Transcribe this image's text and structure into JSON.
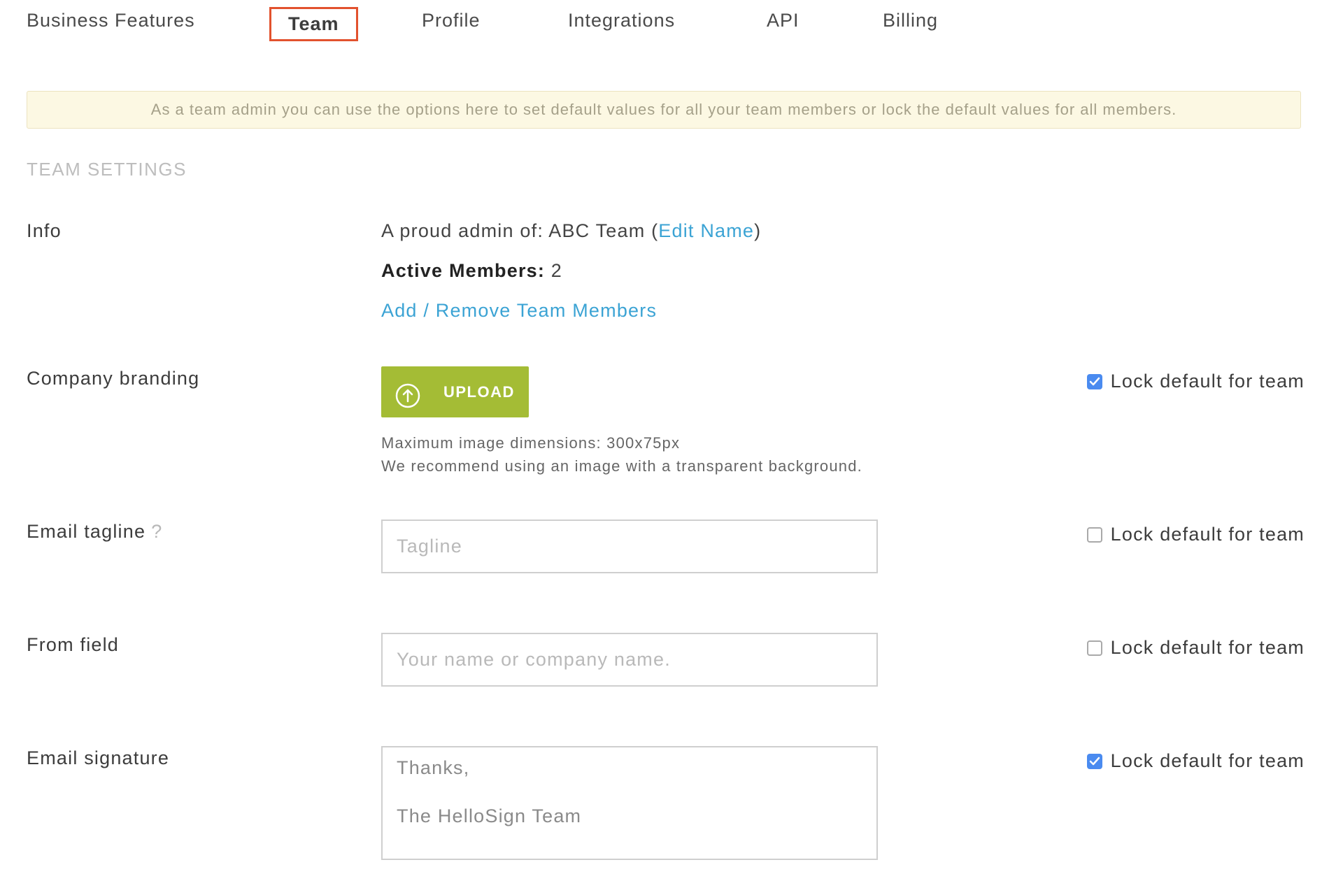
{
  "nav": {
    "tabs": [
      {
        "label": "Business Features"
      },
      {
        "label": "Team",
        "active": true
      },
      {
        "label": "Profile"
      },
      {
        "label": "Integrations"
      },
      {
        "label": "API"
      },
      {
        "label": "Billing"
      }
    ]
  },
  "banner": {
    "text": "As a team admin you can use the options here to set default values for all your team members or lock the default values for all members."
  },
  "section_title": "TEAM SETTINGS",
  "info": {
    "label": "Info",
    "admin_prefix": "A proud admin of: ABC Team (",
    "edit_name": "Edit Name",
    "admin_suffix": ")",
    "active_members_label": "Active Members:",
    "active_members_count": "2",
    "add_remove_link": "Add / Remove Team Members"
  },
  "branding": {
    "label": "Company branding",
    "upload_label": "UPLOAD",
    "hint1": "Maximum image dimensions: 300x75px",
    "hint2": "We recommend using an image with a transparent background.",
    "lock_label": "Lock default for team",
    "locked": true
  },
  "tagline": {
    "label": "Email tagline",
    "help": "?",
    "placeholder": "Tagline",
    "value": "",
    "lock_label": "Lock default for team",
    "locked": false
  },
  "from_field": {
    "label": "From field",
    "placeholder": "Your name or company name.",
    "value": "",
    "lock_label": "Lock default for team",
    "locked": false
  },
  "signature": {
    "label": "Email signature",
    "line1": "Thanks,",
    "line2": "The HelloSign Team",
    "lock_label": "Lock default for team",
    "locked": true
  },
  "colors": {
    "active_tab_border": "#e2522e",
    "link": "#3ba3d4",
    "upload_button": "#a4bc35",
    "checkbox_checked": "#4a8bf0",
    "banner_bg": "#fcf8e3"
  }
}
